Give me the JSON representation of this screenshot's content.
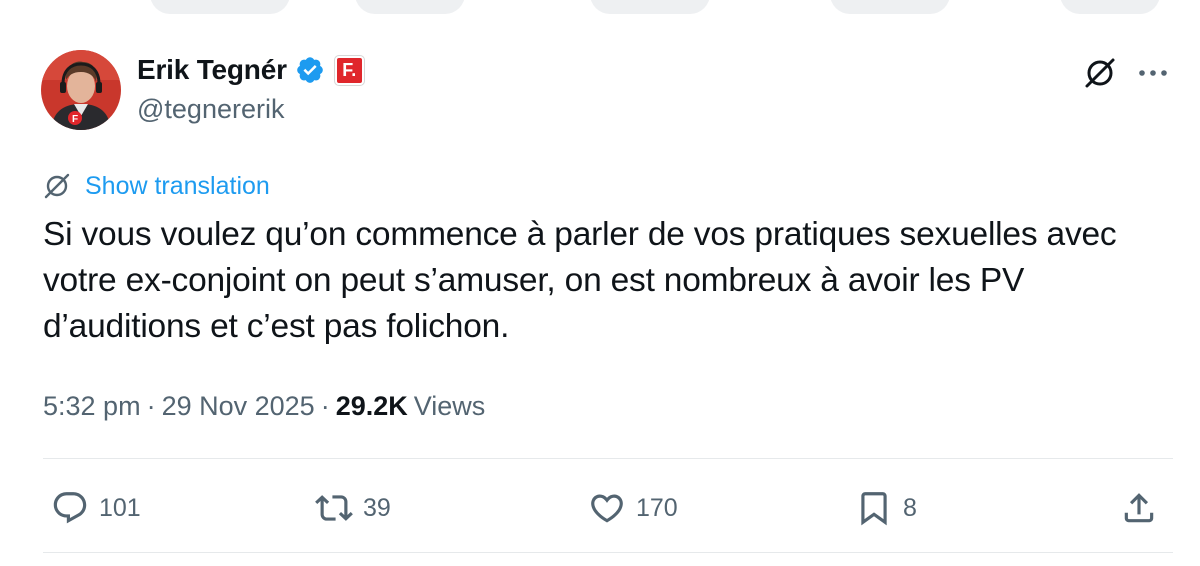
{
  "author": {
    "display_name": "Erik Tegnér",
    "handle": "@tegnererik",
    "affiliate_badge_letter": "F.",
    "avatar": "avatar-photo",
    "verified_color": "#1d9bf0",
    "affiliate_color": "#e0262b"
  },
  "translation": {
    "link_label": "Show translation"
  },
  "tweet": {
    "lines": [
      "Si vous voulez qu’on commence à parler de vos pratiques sexuelles avec",
      "votre ex-conjoint on peut s’amuser, on est nombreux à avoir les PV",
      "d’auditions et c’est pas folichon."
    ],
    "time": "5:32 pm",
    "date": "29 Nov 2025",
    "separator": "·",
    "views_count": "29.2K",
    "views_label": "Views"
  },
  "actions": {
    "reply": {
      "icon": "reply-icon",
      "count": "101"
    },
    "repost": {
      "icon": "repost-icon",
      "count": "39"
    },
    "like": {
      "icon": "heart-icon",
      "count": "170"
    },
    "bookmark": {
      "icon": "bookmark-icon",
      "count": "8"
    },
    "share": {
      "icon": "share-icon"
    }
  },
  "colors": {
    "text_primary": "#0f1419",
    "text_secondary": "#536471",
    "link": "#1d9bf0",
    "divider": "#e6e9eb"
  }
}
